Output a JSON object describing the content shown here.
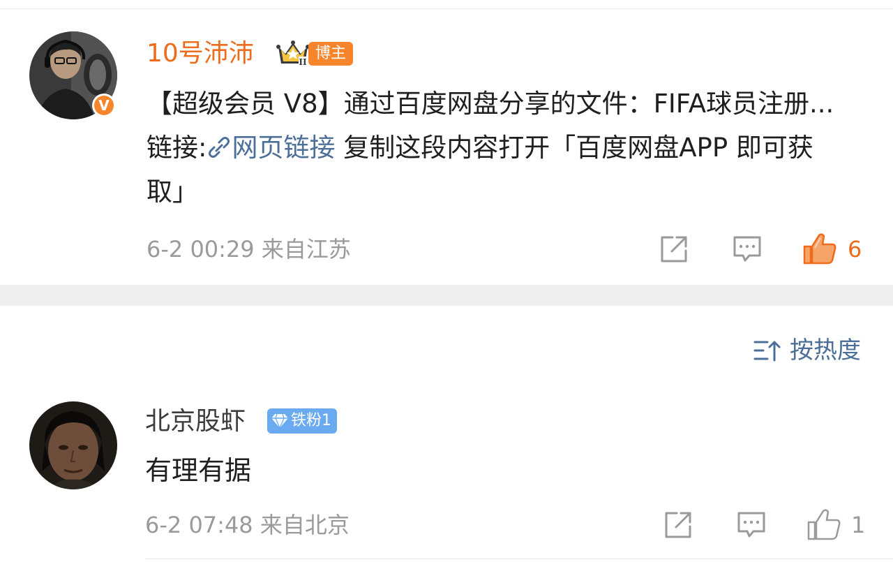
{
  "post": {
    "username": "10号沛沛",
    "crown_icon": "crown-icon",
    "verified_icon": "v-verified-icon",
    "badge_label": "博主",
    "badge_color": "#f7852c",
    "username_color": "#ee6b1b",
    "content_before_link": "【超级会员 V8】通过百度网盘分享的文件：FIFA球员注册... 链接:",
    "link_icon": "link-icon",
    "link_label": "网页链接",
    "content_after_link": " 复制这段内容打开「百度网盘APP 即可获取」",
    "timestamp": "6-2 00:29",
    "source": "来自江苏",
    "like_count": "6",
    "like_color": "#ee6b1b",
    "actions": [
      "share-icon",
      "comment-icon",
      "like-icon"
    ]
  },
  "sort": {
    "icon": "sort-icon",
    "label": "按热度",
    "color": "#4c6f99"
  },
  "comment": {
    "username": "北京股虾",
    "fan_icon": "diamond-icon",
    "fan_badge": "铁粉1",
    "fan_badge_color": "#6aaaf0",
    "content": "有理有据",
    "timestamp": "6-2 07:48",
    "source": "来自北京",
    "like_count": "1",
    "actions": [
      "share-icon",
      "comment-icon",
      "like-icon"
    ]
  }
}
